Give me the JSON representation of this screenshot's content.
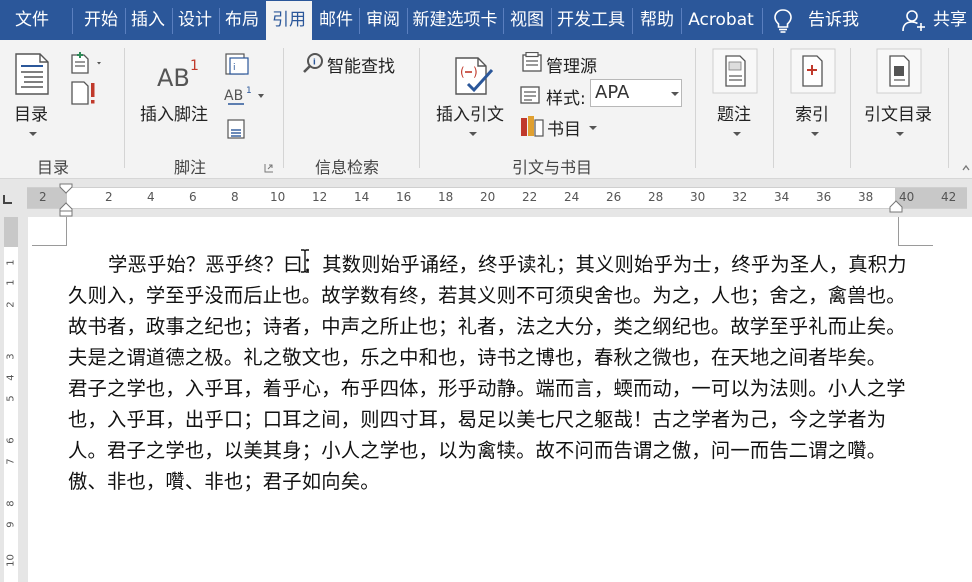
{
  "tabs": [
    {
      "id": "file",
      "label": "文件"
    },
    {
      "id": "home",
      "label": "开始"
    },
    {
      "id": "insert",
      "label": "插入"
    },
    {
      "id": "design",
      "label": "设计"
    },
    {
      "id": "layout",
      "label": "布局"
    },
    {
      "id": "references",
      "label": "引用",
      "active": true
    },
    {
      "id": "mailings",
      "label": "邮件"
    },
    {
      "id": "review",
      "label": "审阅"
    },
    {
      "id": "newtab",
      "label": "新建选项卡"
    },
    {
      "id": "view",
      "label": "视图"
    },
    {
      "id": "developer",
      "label": "开发工具"
    },
    {
      "id": "help",
      "label": "帮助"
    },
    {
      "id": "acrobat",
      "label": "Acrobat"
    }
  ],
  "tellme": {
    "label": "告诉我",
    "icon": "lightbulb-icon"
  },
  "share": {
    "label": "共享",
    "icon": "person-add-icon"
  },
  "ribbon": {
    "toc": {
      "button": "目录",
      "group": "目录"
    },
    "footnotes": {
      "insert_footnote": "插入脚注",
      "group": "脚注"
    },
    "research": {
      "smart_lookup": "智能查找",
      "group": "信息检索"
    },
    "citations": {
      "insert_citation": "插入引文",
      "manage_sources": "管理源",
      "style_label": "样式:",
      "style_value": "APA",
      "bibliography": "书目",
      "group": "引文与书目"
    },
    "captions": {
      "button": "题注"
    },
    "index": {
      "button": "索引"
    },
    "toa": {
      "button": "引文目录"
    }
  },
  "ruler": {
    "numbers": [
      "2",
      "2",
      "4",
      "6",
      "8",
      "10",
      "12",
      "14",
      "16",
      "18",
      "20",
      "22",
      "24",
      "26",
      "28",
      "30",
      "32",
      "34",
      "36",
      "38",
      "40",
      "42"
    ],
    "vnumbers": [
      "1",
      "1",
      "2",
      "3",
      "4",
      "5",
      "6",
      "7",
      "8",
      "9",
      "10"
    ]
  },
  "document": {
    "paragraph": "学恶乎始？恶乎终？曰：其数则始乎诵经，终乎读礼；其义则始乎为士，终乎为圣人，真积力久则入，学至乎没而后止也。故学数有终，若其义则不可须臾舍也。为之，人也；舍之，禽兽也。故书者，政事之纪也；诗者，中声之所止也；礼者，法之大分，类之纲纪也。故学至乎礼而止矣。夫是之谓道德之极。礼之敬文也，乐之中和也，诗书之博也，春秋之微也，在天地之间者毕矣。 君子之学也，入乎耳，着乎心，布乎四体，形乎动静。端而言，蝡而动，一可以为法则。小人之学也，入乎耳，出乎口；口耳之间，则四寸耳，曷足以美七尺之躯哉！古之学者为己，今之学者为人。君子之学也，以美其身；小人之学也，以为禽犊。故不问而告谓之傲，问一而告二谓之囋。傲、非也，囋、非也；君子如向矣。"
  },
  "colors": {
    "tabbar": "#2b579a",
    "ribbon": "#f3f3f3",
    "accent": "#2b579a",
    "icon_red": "#c0392b"
  }
}
